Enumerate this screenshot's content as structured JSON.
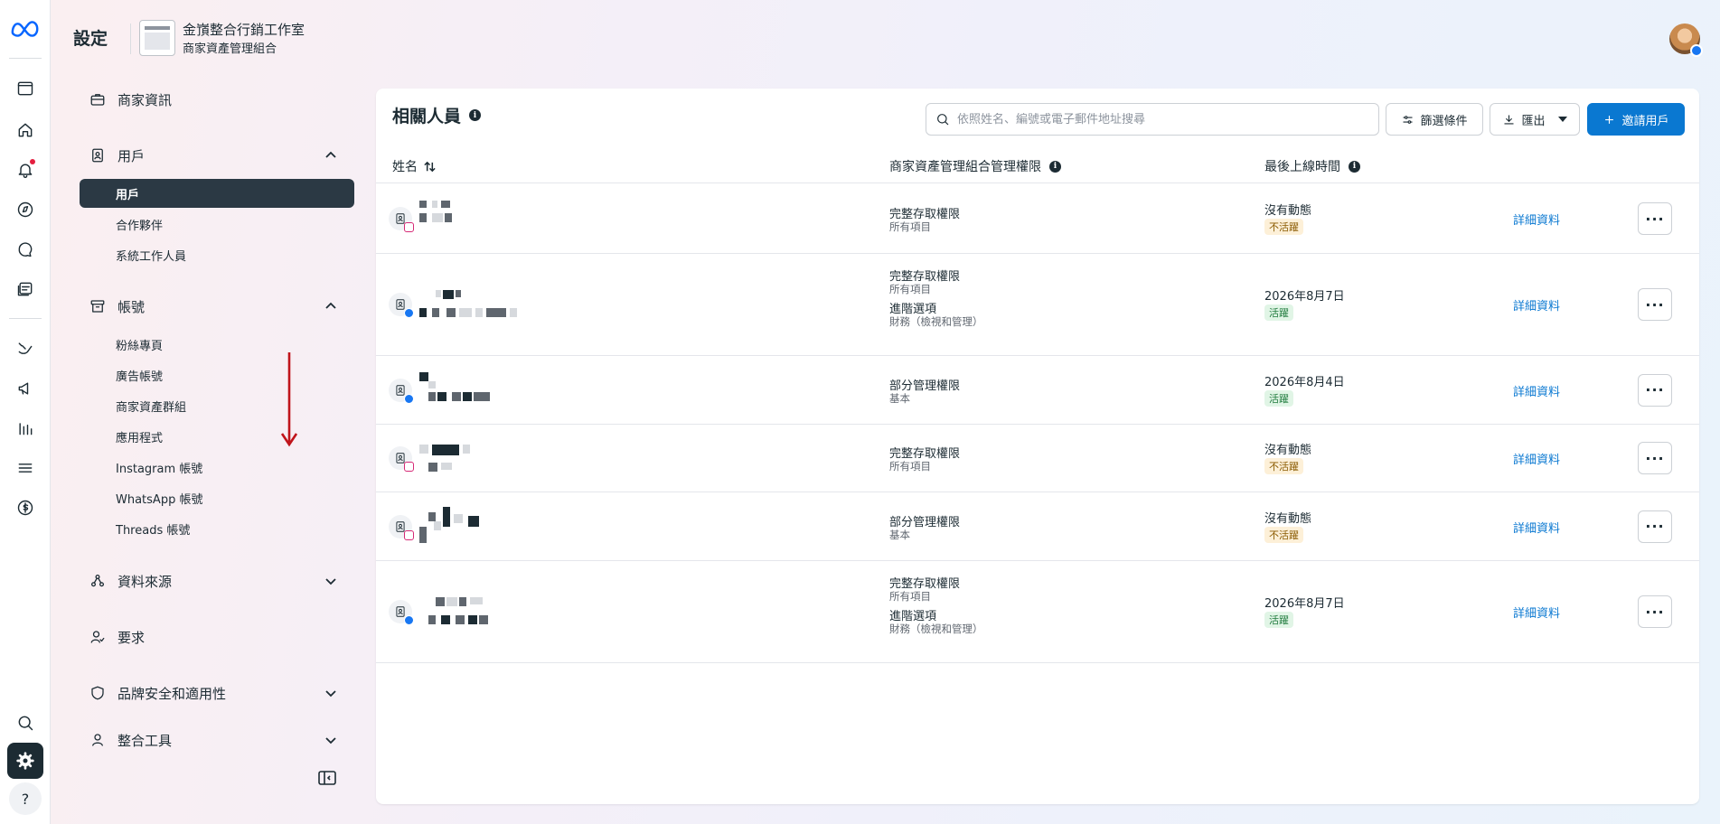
{
  "header": {
    "page_title": "設定",
    "business_name": "金嵿整合行銷工作室",
    "business_subtitle": "商家資產管理組合"
  },
  "sidebar": {
    "business_info": "商家資訊",
    "users": {
      "label": "用戶",
      "items": [
        "用戶",
        "合作夥伴",
        "系統工作人員"
      ]
    },
    "accounts": {
      "label": "帳號",
      "items": [
        "粉絲專頁",
        "廣告帳號",
        "商家資產群組",
        "應用程式",
        "Instagram 帳號",
        "WhatsApp 帳號",
        "Threads 帳號"
      ]
    },
    "data_sources": "資料來源",
    "requests": "要求",
    "brand_safety": "品牌安全和適用性",
    "integrations": "整合工具"
  },
  "people": {
    "title": "相關人員",
    "search_placeholder": "依照姓名、編號或電子郵件地址搜尋",
    "filter_label": "篩選條件",
    "export_label": "匯出",
    "invite_label": "邀請用戶",
    "columns": {
      "name": "姓名",
      "permission": "商家資產管理組合管理權限",
      "last_seen": "最後上線時間"
    },
    "rows": [
      {
        "platform": "instagram",
        "perm": "完整存取權限",
        "perm_sub": "所有項目",
        "extra": "",
        "extra_sub": "",
        "seen": "沒有動態",
        "status": "不活躍",
        "active": false,
        "details": "詳細資料"
      },
      {
        "platform": "facebook",
        "perm": "完整存取權限",
        "perm_sub": "所有項目",
        "extra": "進階選項",
        "extra_sub": "財務（檢視和管理）",
        "seen": "2026年8月7日",
        "status": "活躍",
        "active": true,
        "details": "詳細資料"
      },
      {
        "platform": "facebook",
        "perm": "部分管理權限",
        "perm_sub": "基本",
        "extra": "",
        "extra_sub": "",
        "seen": "2026年8月4日",
        "status": "活躍",
        "active": true,
        "details": "詳細資料"
      },
      {
        "platform": "instagram",
        "perm": "完整存取權限",
        "perm_sub": "所有項目",
        "extra": "",
        "extra_sub": "",
        "seen": "沒有動態",
        "status": "不活躍",
        "active": false,
        "details": "詳細資料"
      },
      {
        "platform": "instagram",
        "perm": "部分管理權限",
        "perm_sub": "基本",
        "extra": "",
        "extra_sub": "",
        "seen": "沒有動態",
        "status": "不活躍",
        "active": false,
        "details": "詳細資料"
      },
      {
        "platform": "facebook",
        "perm": "完整存取權限",
        "perm_sub": "所有項目",
        "extra": "進階選項",
        "extra_sub": "財務（檢視和管理）",
        "seen": "2026年8月7日",
        "status": "活躍",
        "active": true,
        "details": "詳細資料"
      }
    ]
  },
  "colors": {
    "primary": "#0a78d1",
    "active_nav": "#2b3944",
    "annotation_arrow": "#c0141b"
  }
}
